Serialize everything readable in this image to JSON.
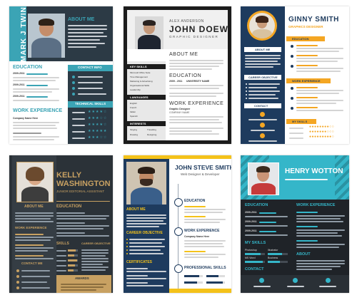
{
  "colors": {
    "teal": "#3ba4b5",
    "navy": "#1e3b5e",
    "orange": "#f4a623",
    "gold": "#c8a162",
    "slate": "#2b3238",
    "dark": "#1f2328",
    "cyan": "#35b6c9"
  },
  "r1": {
    "name": "MARK J TWIN",
    "about": "ABOUT ME",
    "education": "EDUCATION",
    "contact": "CONTACT INFO",
    "technical": "TECHNICAL SKILLS",
    "work": "WORK EXPERIENCE",
    "company": "Company Name Here",
    "years": [
      "2009-2011",
      "2009-2011",
      "2009-2011"
    ]
  },
  "r2": {
    "name_small": "ALEX ANDERSON",
    "name": "JOHN DOEW",
    "role": "GRAPHIC DESIGNER",
    "about": "ABOUT ME",
    "education": "EDUCATION",
    "work": "WORK EXPERIENCE",
    "skills_h": "KEY SKILLS",
    "languages_h": "LANGUAGES",
    "interests_h": "INTERESTS",
    "skills": [
      "Microsoft Office Suite",
      "Time Management",
      "Marketing & Advertising",
      "Organisational Skills",
      "Leadership"
    ],
    "languages": [
      "English",
      "French",
      "Italian",
      "Spanish"
    ],
    "interests": [
      "Singing",
      "Travelling",
      "Drawing",
      "Designing"
    ],
    "edu_year": "2009 - 2011",
    "university": "UNIVERSITY NAME",
    "job": "Graphic Designer",
    "company": "COMPANY NAME"
  },
  "r3": {
    "name": "GINNY SMITH",
    "role": "GRAPHICS DESIGNER",
    "about": "ABOUT ME",
    "career": "CAREER OBJECTIVE",
    "contact": "CONTACT",
    "education": "EDUCATION",
    "work": "WORK EXPERIENCE",
    "skills": "MY SKILLS"
  },
  "r4": {
    "first": "KELLY",
    "last": "WASHINGTON",
    "role": "JUNIOR EDITORIAL ASSISTANT",
    "education": "EDUCATION",
    "about": "ABOUT ME",
    "work": "WORK EXPERIENCE",
    "skills": "SKILLS",
    "career": "CAREER OBJECTIVE",
    "contact": "CONTACT ME",
    "awards": "AWARDS"
  },
  "r5": {
    "name": "JOHN STEVE SMITH",
    "role": "Web Designer & Developer",
    "education": "EDUCATION",
    "about": "ABOUT ME",
    "work": "WORK EXPERIENCE",
    "career": "CAREER OBJECTIVE",
    "cert": "CERTIFICATES",
    "pro": "PROFESSIONAL SKILLS",
    "company": "Company Name Here"
  },
  "r6": {
    "name": "HENRY WOTTON",
    "education": "EDUCATION",
    "work": "WORK EXPERIENCE",
    "myskills": "MY SKILLS",
    "about": "ABOUT",
    "contact": "CONTACT",
    "years": [
      "2009-2011",
      "2009-2011",
      "2009-2011"
    ],
    "skills": [
      "Photoshop",
      "Illustrator",
      "MS Word",
      "Business"
    ]
  }
}
